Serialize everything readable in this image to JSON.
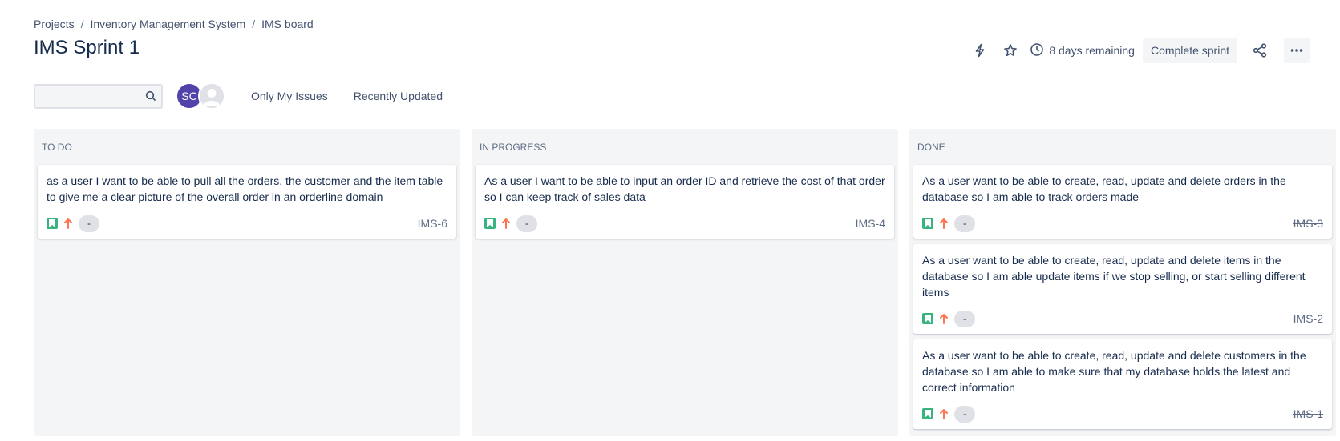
{
  "breadcrumb": {
    "items": [
      "Projects",
      "Inventory Management System",
      "IMS board"
    ],
    "separator": "/"
  },
  "title": "IMS Sprint 1",
  "header": {
    "remaining": "8 days remaining",
    "complete_label": "Complete sprint",
    "icons": [
      "automation-icon",
      "star-icon",
      "clock-icon",
      "share-icon",
      "more-icon"
    ]
  },
  "toolbar": {
    "search_placeholder": "",
    "avatar_initials": "SC",
    "filters": [
      "Only My Issues",
      "Recently Updated"
    ]
  },
  "colors": {
    "story_green": "#36b37e",
    "priority_orange": "#ff7452",
    "avatar_purple": "#5243aa",
    "column_bg": "#f4f5f7"
  },
  "columns": [
    {
      "title": "TO DO",
      "cards": [
        {
          "summary": "as a user I want to be able to pull all the orders, the customer and the item table to give me a clear picture of the overall order in an orderline domain",
          "estimate": "-",
          "key": "IMS-6",
          "done": false
        }
      ]
    },
    {
      "title": "IN PROGRESS",
      "cards": [
        {
          "summary": "As a user I want to be able to input an order ID and retrieve the cost of that order so I can keep track of sales data",
          "estimate": "-",
          "key": "IMS-4",
          "done": false
        }
      ]
    },
    {
      "title": "DONE",
      "cards": [
        {
          "summary": "As a user want to be able to create, read, update and delete orders in the database so I am able to track orders made",
          "estimate": "-",
          "key": "IMS-3",
          "done": true
        },
        {
          "summary": "As a user want to be able to create, read, update and delete items in the database so I am able update items if we stop selling, or start selling different items",
          "estimate": "-",
          "key": "IMS-2",
          "done": true
        },
        {
          "summary": "As a user want to be able to create, read, update and delete customers in the database so I am able to make sure that my database holds the latest and correct information",
          "estimate": "-",
          "key": "IMS-1",
          "done": true
        }
      ]
    }
  ]
}
